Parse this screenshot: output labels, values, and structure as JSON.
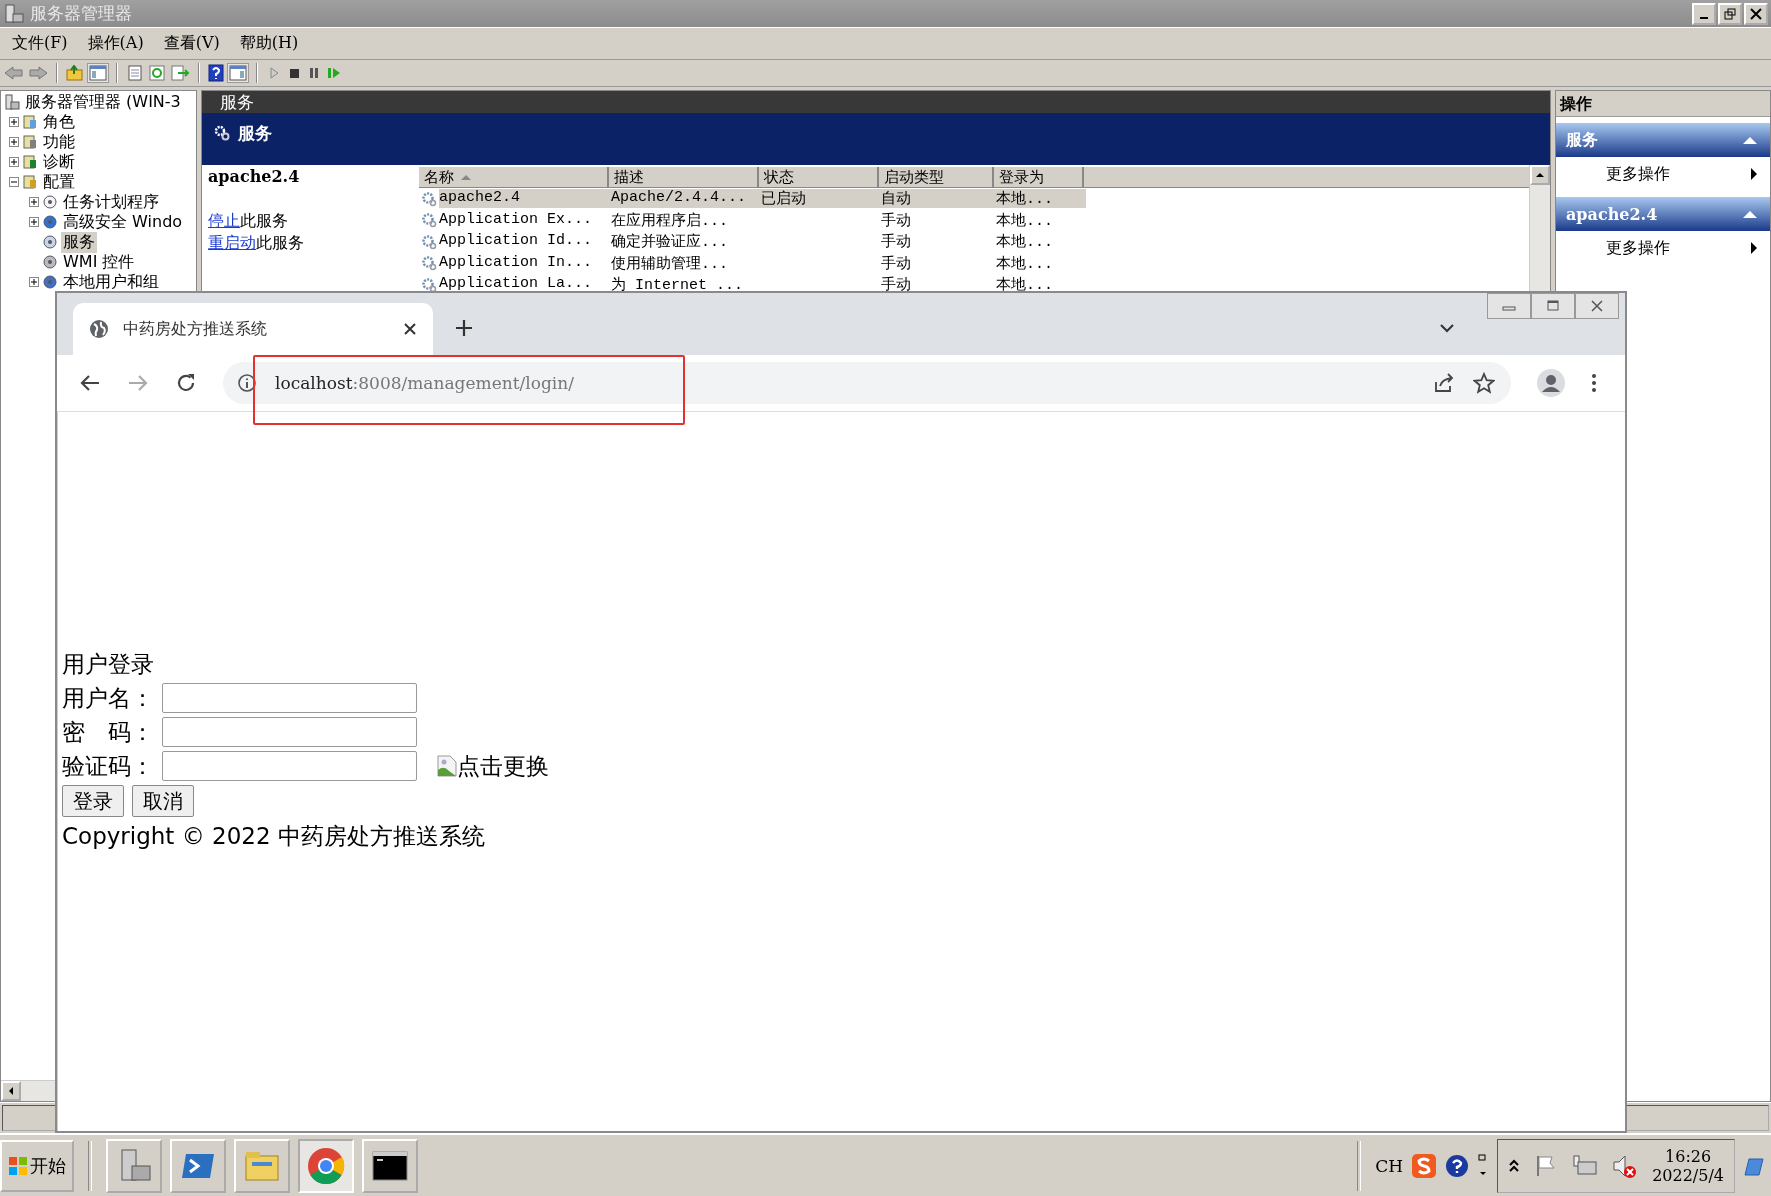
{
  "window": {
    "title": "服务器管理器"
  },
  "menu": [
    {
      "label": "文件(F)"
    },
    {
      "label": "操作(A)"
    },
    {
      "label": "查看(V)"
    },
    {
      "label": "帮助(H)"
    }
  ],
  "tree": {
    "label": "服务器管理器 (WIN-3",
    "children": [
      {
        "label": "角色",
        "kind": "branch",
        "expanded": false,
        "selected": false
      },
      {
        "label": "功能",
        "kind": "branch",
        "expanded": false,
        "selected": false
      },
      {
        "label": "诊断",
        "kind": "branch",
        "expanded": false,
        "selected": false
      },
      {
        "label": "配置",
        "kind": "branch",
        "expanded": true,
        "selected": false,
        "children": [
          {
            "label": "任务计划程序",
            "kind": "branch",
            "expanded": false,
            "selected": false
          },
          {
            "label": "高级安全 Windo",
            "kind": "branch",
            "expanded": false,
            "selected": false
          },
          {
            "label": "服务",
            "kind": "leaf",
            "selected": true
          },
          {
            "label": "WMI 控件",
            "kind": "leaf",
            "selected": false
          },
          {
            "label": "本地用户和组",
            "kind": "branch",
            "expanded": false,
            "selected": false
          }
        ]
      }
    ]
  },
  "services": {
    "pane_title": "服务",
    "banner": "服务",
    "selected_service": "apache2.4",
    "actions": [
      {
        "link": "停止",
        "text": "此服务"
      },
      {
        "link": "重启动",
        "text": "此服务"
      }
    ],
    "columns": [
      {
        "label": "名称",
        "sorted": true
      },
      {
        "label": "描述",
        "sorted": false
      },
      {
        "label": "状态",
        "sorted": false
      },
      {
        "label": "启动类型",
        "sorted": false
      },
      {
        "label": "登录为",
        "sorted": false
      }
    ],
    "rows": [
      {
        "name": "apache2.4",
        "description": "Apache/2.4.4...",
        "status": "已启动",
        "startup": "自动",
        "logon": "本地...",
        "selected": true
      },
      {
        "name": "Application Ex...",
        "description": "在应用程序启...",
        "startup": "手动",
        "logon": "本地...",
        "selected": false
      },
      {
        "name": "Application Id...",
        "description": "确定并验证应...",
        "startup": "手动",
        "logon": "本地...",
        "selected": false
      },
      {
        "name": "Application In...",
        "description": "使用辅助管理...",
        "startup": "手动",
        "logon": "本地...",
        "selected": false
      },
      {
        "name": "Application La...",
        "description": "为 Internet ...",
        "startup": "手动",
        "logon": "本地...",
        "selected": false
      }
    ]
  },
  "actions_pane": {
    "title": "操作",
    "sections": [
      {
        "title": "服务",
        "expanded": true,
        "items": [
          "更多操作"
        ]
      },
      {
        "title": "apache2.4",
        "expanded": true,
        "items": [
          "更多操作"
        ]
      }
    ]
  },
  "browser": {
    "tab": {
      "title": "中药房处方推送系统",
      "selected": true
    },
    "url": {
      "host": "localhost",
      "rest": ":8008/management/login/"
    },
    "page": {
      "heading": "用户登录",
      "fields": [
        {
          "label": "用户名：",
          "kind": "text"
        },
        {
          "label": "密　码：",
          "kind": "password"
        },
        {
          "label": "验证码：",
          "kind": "captcha",
          "image_alt": "点击更换"
        }
      ],
      "buttons": [
        "登录",
        "取消"
      ],
      "footer": "Copyright © 2022 中药房处方推送系统"
    }
  },
  "taskbar": {
    "start": "开始",
    "apps": [
      {
        "kind": "server",
        "selected": false
      },
      {
        "kind": "powershell",
        "selected": false
      },
      {
        "kind": "explorer",
        "selected": false
      },
      {
        "kind": "chrome",
        "selected": true
      },
      {
        "kind": "cmd",
        "selected": false
      }
    ],
    "tray": {
      "language": "CH",
      "time": "16:26",
      "date": "2022/5/4"
    }
  }
}
